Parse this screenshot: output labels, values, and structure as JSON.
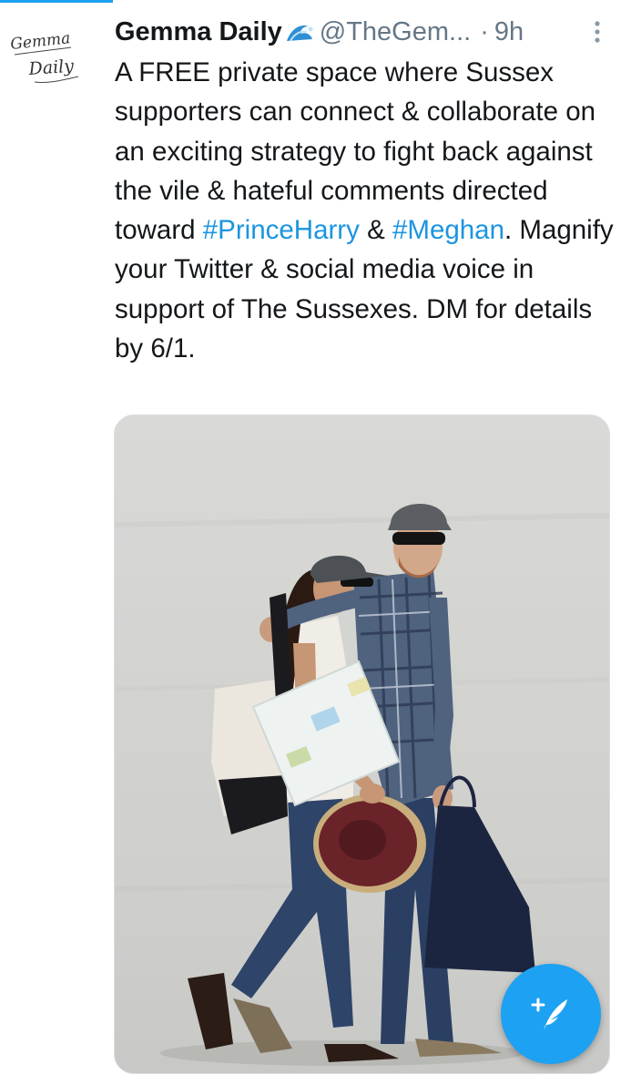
{
  "tweet": {
    "author_name": "Gemma Daily",
    "handle": "@TheGem...",
    "separator": "·",
    "time": "9h",
    "avatar_text_line1": "Gemma",
    "avatar_text_line2": "Daily",
    "text_before_tag1": "A FREE private space where Sussex supporters can connect & collaborate on an exciting strategy to fight back against the vile & hateful comments directed toward ",
    "hashtag1": "#PrinceHarry",
    "text_between_tags": " & ",
    "hashtag2": "#Meghan",
    "text_after_tags": ".   Magnify your Twitter & social media voice in support of The Sussexes. DM for details by 6/1."
  },
  "icons": {
    "verified_badge": "wave-emoji-icon",
    "more": "more-vertical-icon",
    "compose": "compose-tweet-icon"
  },
  "colors": {
    "accent": "#1da1f2",
    "hashtag": "#1b95e0",
    "secondary_text": "#657786"
  }
}
